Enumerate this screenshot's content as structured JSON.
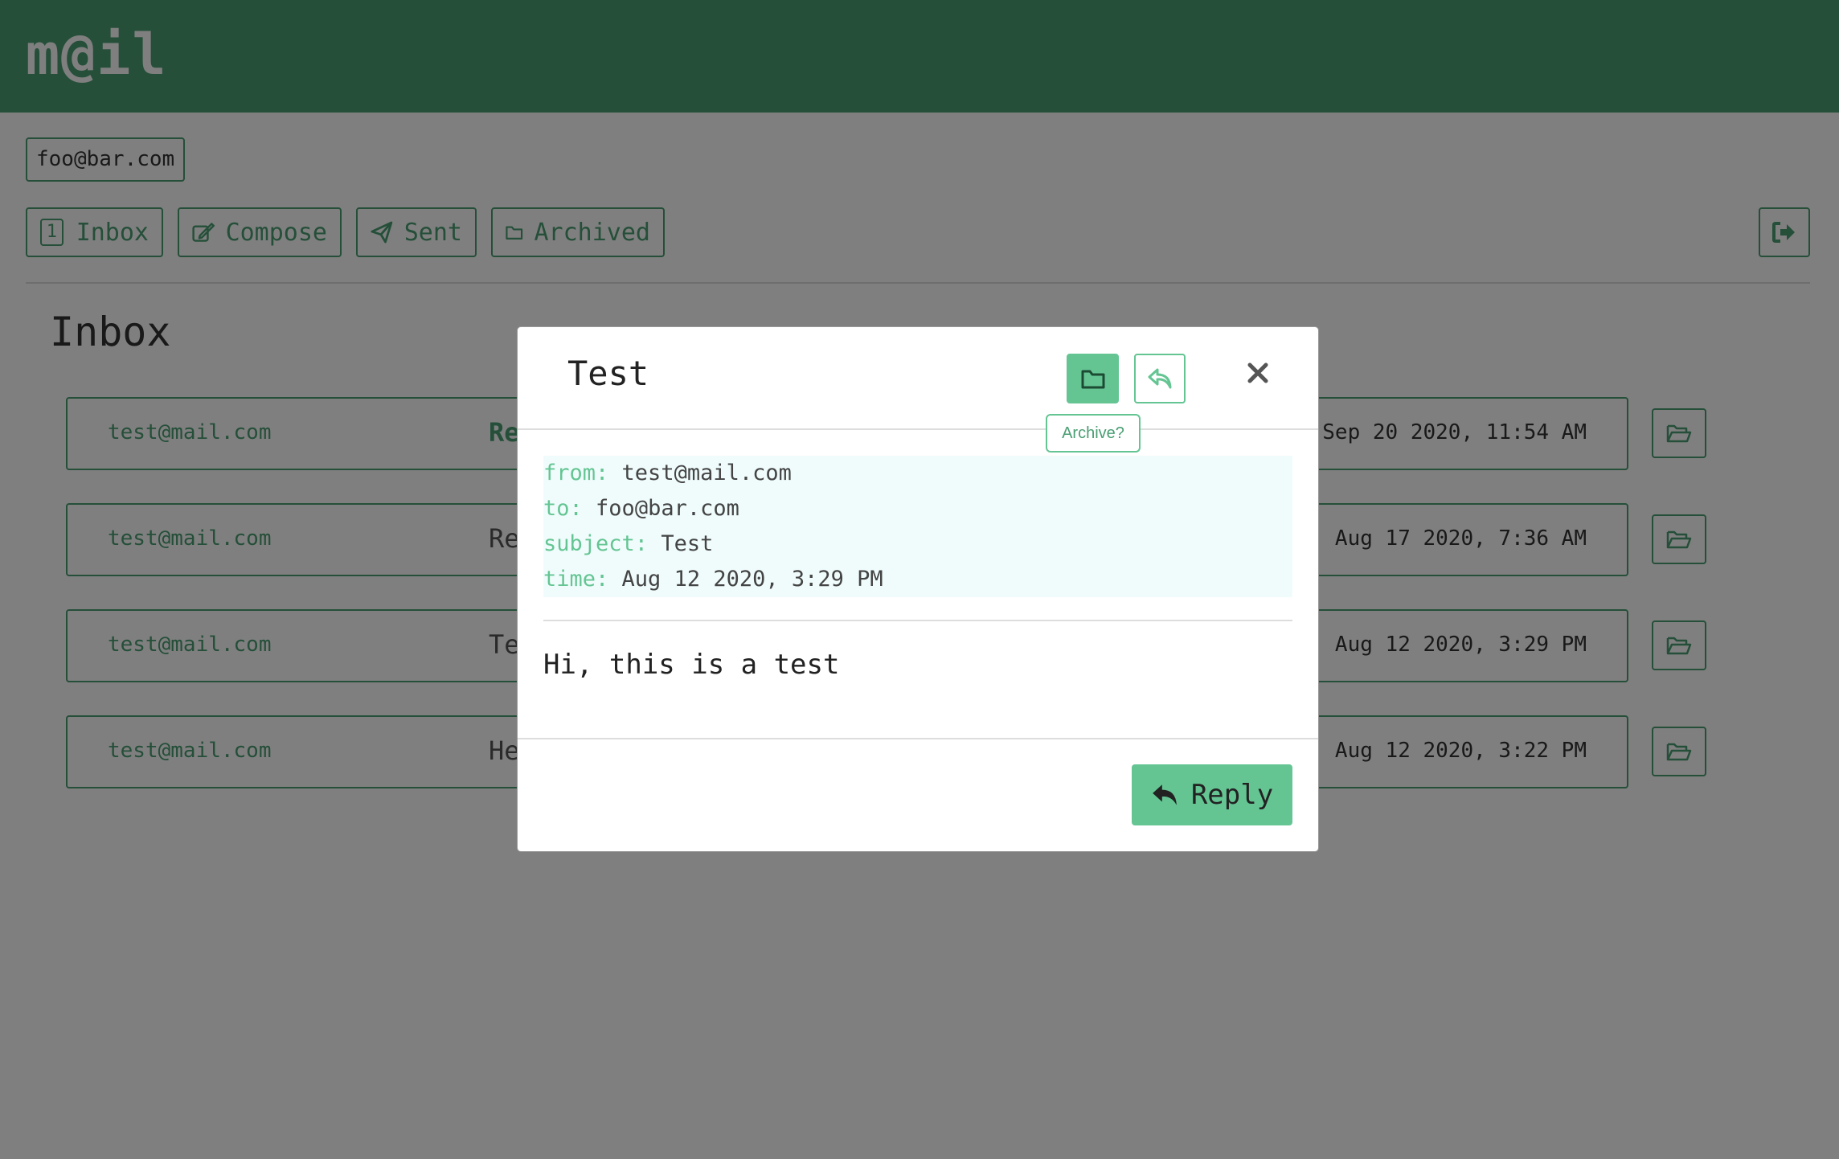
{
  "app": {
    "logo": "m@il"
  },
  "account": {
    "email": "foo@bar.com"
  },
  "nav": {
    "inbox_count": "1",
    "inbox_label": "Inbox",
    "compose_label": "Compose",
    "sent_label": "Sent",
    "archived_label": "Archived"
  },
  "page": {
    "title": "Inbox"
  },
  "mails": [
    {
      "from": "test@mail.com",
      "subject": "Re",
      "time": "Sep 20 2020, 11:54 AM",
      "unread": true
    },
    {
      "from": "test@mail.com",
      "subject": "Re",
      "time": "Aug 17 2020, 7:36 AM",
      "unread": false
    },
    {
      "from": "test@mail.com",
      "subject": "Te",
      "time": "Aug 12 2020, 3:29 PM",
      "unread": false
    },
    {
      "from": "test@mail.com",
      "subject": "He",
      "time": "Aug 12 2020, 3:22 PM",
      "unread": false
    }
  ],
  "modal": {
    "title": "Test",
    "archive_tooltip": "Archive?",
    "from_key": "from:",
    "from_val": "test@mail.com",
    "to_key": "to:",
    "to_val": "foo@bar.com",
    "subject_key": "subject:",
    "subject_val": "Test",
    "time_key": "time:",
    "time_val": "Aug 12 2020, 3:29 PM",
    "body": "Hi, this is a test",
    "reply_label": "Reply"
  },
  "icons": {
    "archive": "folder-icon",
    "reply": "reply-icon",
    "close": "close-icon",
    "compose": "edit-icon",
    "sent": "paper-plane-icon",
    "archived": "folder-icon",
    "logout": "sign-out-icon",
    "row_archive": "folder-open-icon"
  },
  "colors": {
    "header": "#4a9e73",
    "accent": "#64c593",
    "meta_bg": "#f0fcfc"
  }
}
